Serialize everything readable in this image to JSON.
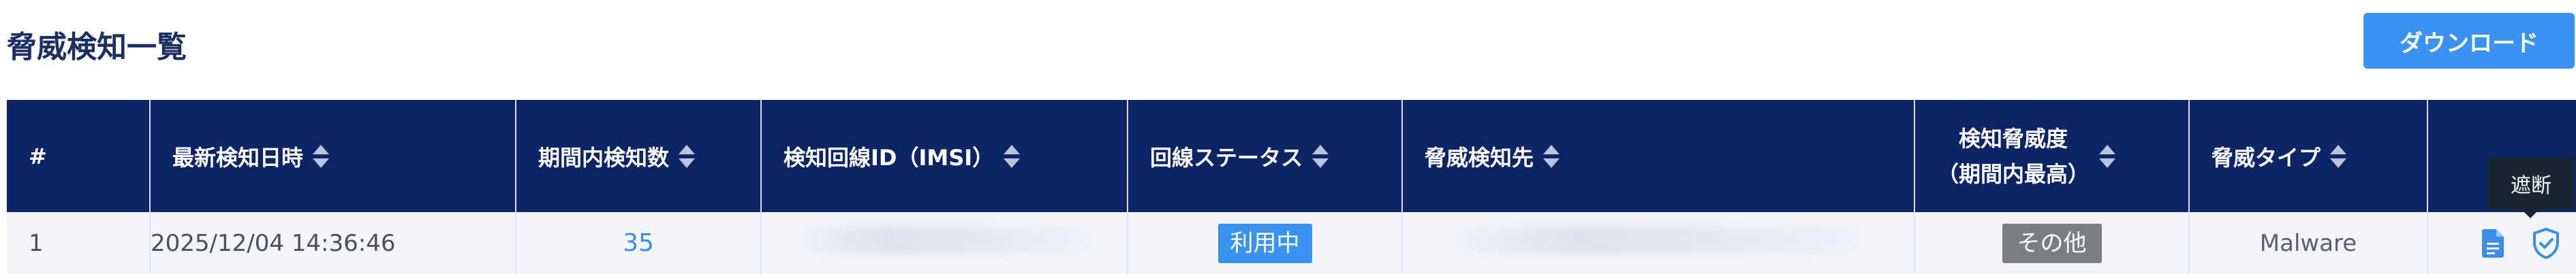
{
  "page": {
    "title": "脅威検知一覧",
    "download_label": "ダウンロード"
  },
  "table": {
    "headers": [
      {
        "label": "#",
        "sortable": false
      },
      {
        "label": "最新検知日時",
        "sortable": true
      },
      {
        "label": "期間内検知数",
        "sortable": true
      },
      {
        "label": "検知回線ID（IMSI）",
        "sortable": true
      },
      {
        "label": "回線ステータス",
        "sortable": true
      },
      {
        "label": "脅威検知先",
        "sortable": true
      },
      {
        "label_line1": "検知脅威度",
        "label_line2": "（期間内最高）",
        "sortable": true
      },
      {
        "label": "脅威タイプ",
        "sortable": true
      },
      {
        "label": "",
        "sortable": false
      }
    ],
    "rows": [
      {
        "index": "1",
        "latest_detected": "2025/12/04 14:36:46",
        "count": "35",
        "line_id": "",
        "line_status": "利用中",
        "threat_destination": "",
        "severity": "その他",
        "threat_type": "Malware"
      }
    ]
  },
  "actions": {
    "detail_icon": "document-icon",
    "block_icon": "shield-check-icon",
    "tooltip": "遮断"
  },
  "colors": {
    "header_bg": "#0d2466",
    "title": "#1b2f63",
    "accent": "#3c92f0",
    "severity_badge": "#7a7d82"
  }
}
